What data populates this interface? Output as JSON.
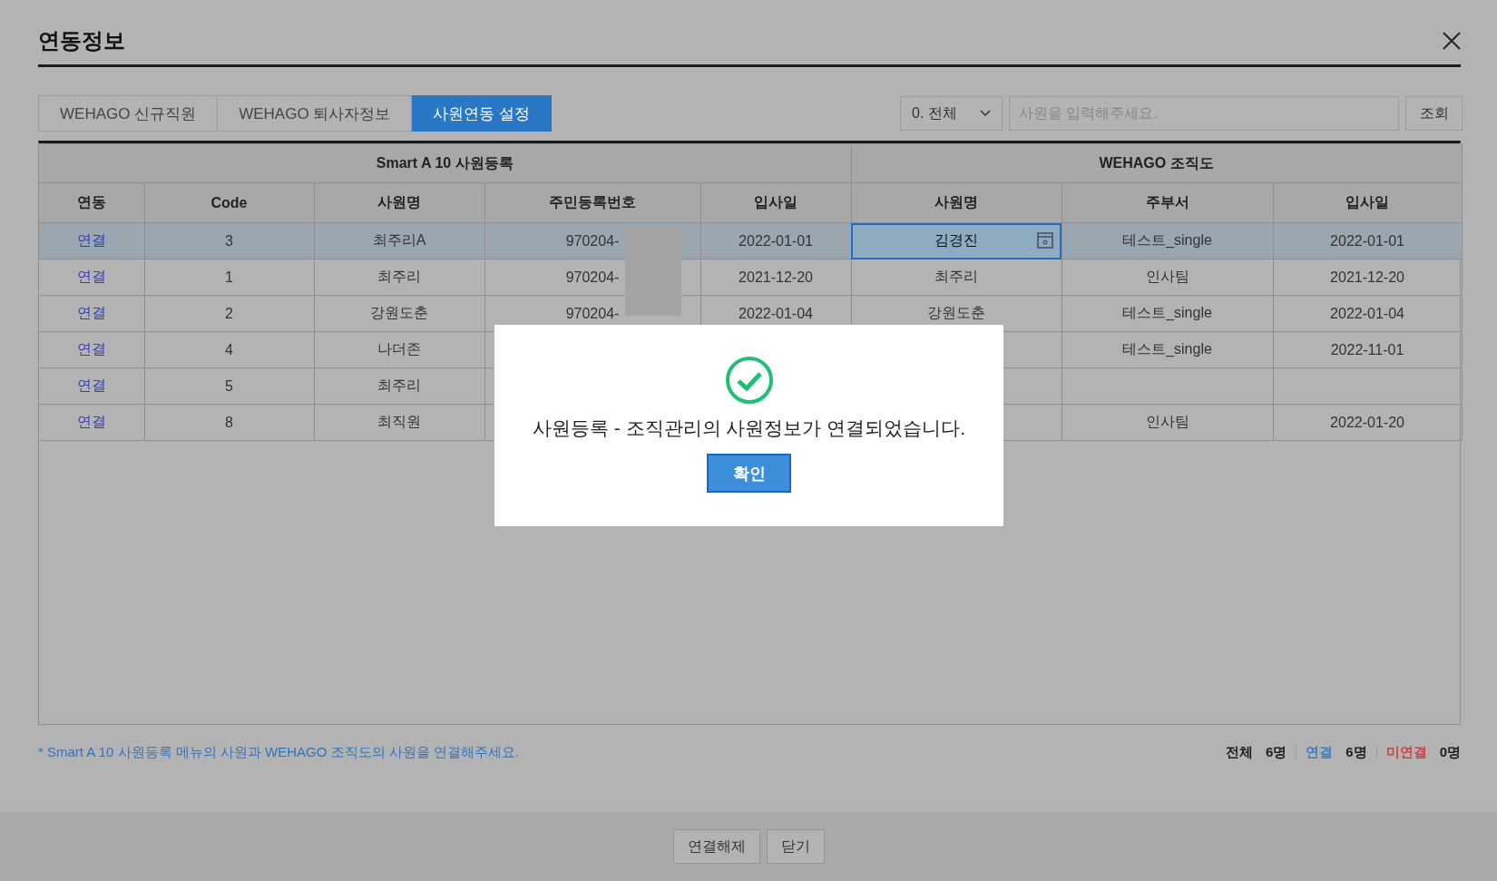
{
  "window": {
    "title": "연동정보"
  },
  "tabs": [
    {
      "label": "WEHAGO 신규직원",
      "selected": false
    },
    {
      "label": "WEHAGO 퇴사자정보",
      "selected": false
    },
    {
      "label": "사원연동 설정",
      "selected": true
    }
  ],
  "filter": {
    "value": "0. 전체"
  },
  "search": {
    "placeholder": "사원을 입력해주세요."
  },
  "search_button": "조회",
  "table": {
    "groups": [
      "Smart A 10 사원등록",
      "WEHAGO 조직도"
    ],
    "columns": [
      "연동",
      "Code",
      "사원명",
      "주민등록번호",
      "입사일",
      "사원명",
      "주부서",
      "입사일"
    ],
    "rows": [
      {
        "link": "연결",
        "code": "3",
        "name": "최주리A",
        "id_number": "970204-",
        "hire_date": "2022-01-01",
        "wehago_name": "김경진",
        "department": "테스트_single",
        "wehago_hire_date": "2022-01-01",
        "selected": true
      },
      {
        "link": "연결",
        "code": "1",
        "name": "최주리",
        "id_number": "970204-",
        "hire_date": "2021-12-20",
        "wehago_name": "최주리",
        "department": "인사팀",
        "wehago_hire_date": "2021-12-20",
        "selected": false
      },
      {
        "link": "연결",
        "code": "2",
        "name": "강원도춘",
        "id_number": "970204-",
        "hire_date": "2022-01-04",
        "wehago_name": "강원도춘",
        "department": "테스트_single",
        "wehago_hire_date": "2022-01-04",
        "selected": false
      },
      {
        "link": "연결",
        "code": "4",
        "name": "나더존",
        "department": "테스트_single",
        "wehago_hire_date": "2022-11-01",
        "selected": false
      },
      {
        "link": "연결",
        "code": "5",
        "name": "최주리",
        "selected": false
      },
      {
        "link": "연결",
        "code": "8",
        "name": "최직원",
        "department": "인사팀",
        "wehago_hire_date": "2022-01-20",
        "selected": false
      }
    ]
  },
  "note": "* Smart A 10 사원등록 메뉴의 사원과 WEHAGO 조직도의 사원을 연결해주세요.",
  "summary": [
    {
      "label": "전체",
      "count": "6명",
      "color": "#222222"
    },
    {
      "label": "연결",
      "count": "6명",
      "color": "#3f7fc4"
    },
    {
      "label": "미연결",
      "count": "0명",
      "color": "#cc4444"
    }
  ],
  "buttons": [
    "연결해제",
    "닫기"
  ],
  "dialog": {
    "message": "사원등록 - 조직관리의 사원정보가 연결되었습니다.",
    "button": "확인"
  }
}
